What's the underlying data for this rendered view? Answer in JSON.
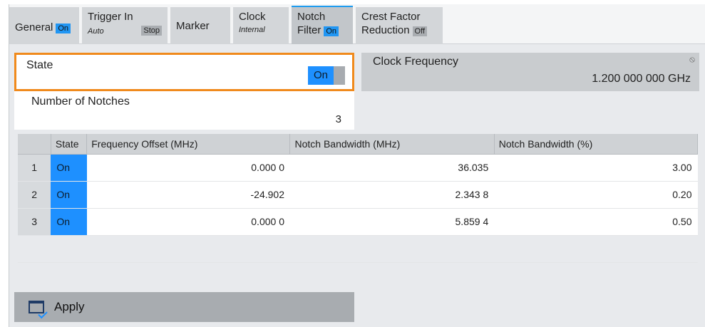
{
  "tabs": [
    {
      "label": "General",
      "badge": "On"
    },
    {
      "label": "Trigger In",
      "sub": "Auto",
      "badge": "Stop"
    },
    {
      "label": "Marker"
    },
    {
      "label": "Clock",
      "sub": "Internal"
    },
    {
      "label_line1": "Notch",
      "label_line2": "Filter",
      "badge": "On",
      "active": true
    },
    {
      "label_line1": "Crest Factor",
      "label_line2": "Reduction",
      "badge": "Off"
    }
  ],
  "state": {
    "label": "State",
    "value": "On"
  },
  "notches": {
    "label": "Number of Notches",
    "value": "3"
  },
  "clock": {
    "label": "Clock Frequency",
    "value": "1.200 000 000 GHz"
  },
  "table": {
    "headers": [
      "",
      "State",
      "Frequency Offset (MHz)",
      "Notch Bandwidth (MHz)",
      "Notch Bandwidth (%)"
    ],
    "rows": [
      {
        "num": "1",
        "state": "On",
        "offset": "0.000 0",
        "bw_mhz": "36.035",
        "bw_pct": "3.00"
      },
      {
        "num": "2",
        "state": "On",
        "offset": "-24.902",
        "bw_mhz": "2.343 8",
        "bw_pct": "0.20"
      },
      {
        "num": "3",
        "state": "On",
        "offset": "0.000 0",
        "bw_mhz": "5.859 4",
        "bw_pct": "0.50"
      }
    ]
  },
  "apply": {
    "label": "Apply"
  },
  "colors": {
    "accent": "#1e90ff",
    "focus": "#f08a1c"
  }
}
